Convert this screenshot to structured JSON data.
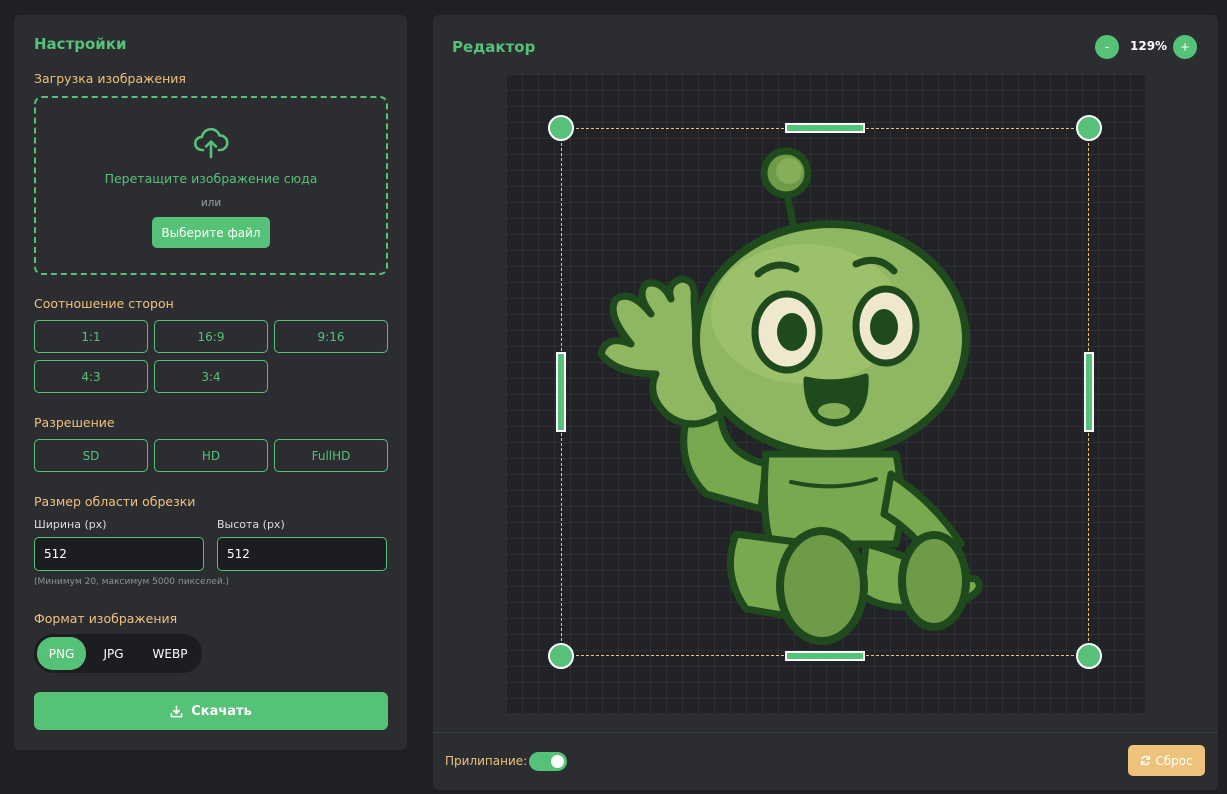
{
  "settings": {
    "title": "Настройки",
    "upload": {
      "label": "Загрузка изображения",
      "drop_text": "Перетащите изображение сюда",
      "or_text": "или",
      "choose_button": "Выберите файл"
    },
    "aspect": {
      "label": "Соотношение сторон",
      "options": [
        "1:1",
        "16:9",
        "9:16",
        "4:3",
        "3:4"
      ]
    },
    "resolution": {
      "label": "Разрешение",
      "options": [
        "SD",
        "HD",
        "FullHD"
      ]
    },
    "crop_size": {
      "label": "Размер области обрезки",
      "width_label": "Ширина (px)",
      "width_value": "512",
      "height_label": "Высота (px)",
      "height_value": "512",
      "hint": "(Минимум 20, максимум 5000 пикселей.)"
    },
    "format": {
      "label": "Формат изображения",
      "options": [
        "PNG",
        "JPG",
        "WEBP"
      ],
      "selected": "PNG"
    },
    "download_button": "Скачать"
  },
  "editor": {
    "title": "Редактор",
    "zoom_out": "-",
    "zoom_value": "129%",
    "zoom_in": "+",
    "snap_label": "Прилипание:",
    "snap_enabled": true,
    "reset_button": "Сброс"
  },
  "colors": {
    "accent": "#55c278",
    "secondary": "#efc27c",
    "panel": "#2b2d31",
    "background": "#1f2023"
  }
}
